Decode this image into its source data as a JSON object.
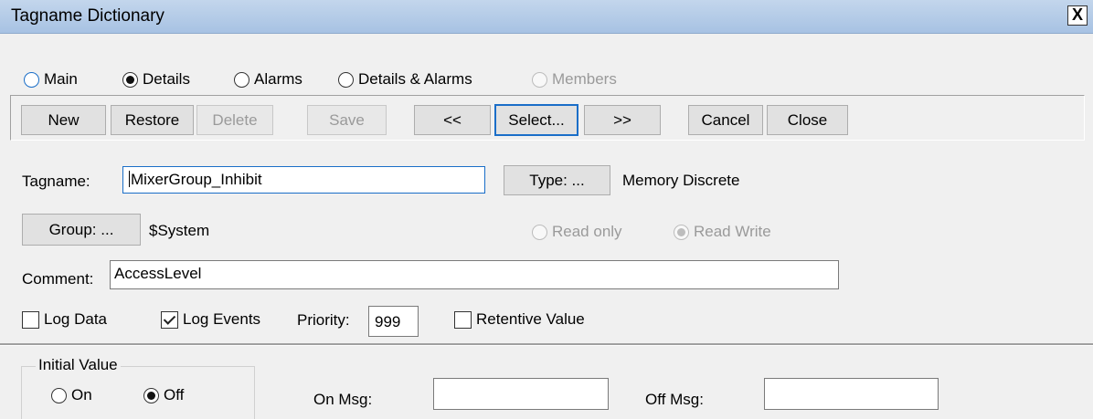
{
  "window": {
    "title": "Tagname Dictionary",
    "close_label": "X"
  },
  "view_modes": [
    {
      "label": "Main",
      "checked": false,
      "disabled": false
    },
    {
      "label": "Details",
      "checked": true,
      "disabled": false
    },
    {
      "label": "Alarms",
      "checked": false,
      "disabled": false
    },
    {
      "label": "Details & Alarms",
      "checked": false,
      "disabled": false
    },
    {
      "label": "Members",
      "checked": false,
      "disabled": true
    }
  ],
  "toolbar": {
    "new": "New",
    "restore": "Restore",
    "delete": "Delete",
    "save": "Save",
    "prev": "<<",
    "select": "Select...",
    "next": ">>",
    "cancel": "Cancel",
    "close": "Close"
  },
  "form": {
    "tagname_label": "Tagname:",
    "tagname_value": "MixerGroup_Inhibit",
    "type_button": "Type: ...",
    "type_value": "Memory Discrete",
    "group_button": "Group: ...",
    "group_value": "$System",
    "access": [
      {
        "label": "Read only",
        "checked": false
      },
      {
        "label": "Read Write",
        "checked": true
      }
    ],
    "comment_label": "Comment:",
    "comment_value": "AccessLevel",
    "log_data_label": "Log Data",
    "log_data_checked": false,
    "log_events_label": "Log Events",
    "log_events_checked": true,
    "priority_label": "Priority:",
    "priority_value": "999",
    "retentive_label": "Retentive Value",
    "retentive_checked": false
  },
  "details": {
    "initial_value_label": "Initial Value",
    "on_label": "On",
    "on_checked": false,
    "off_label": "Off",
    "off_checked": true,
    "on_msg_label": "On Msg:",
    "on_msg_value": "",
    "off_msg_label": "Off Msg:",
    "off_msg_value": ""
  }
}
